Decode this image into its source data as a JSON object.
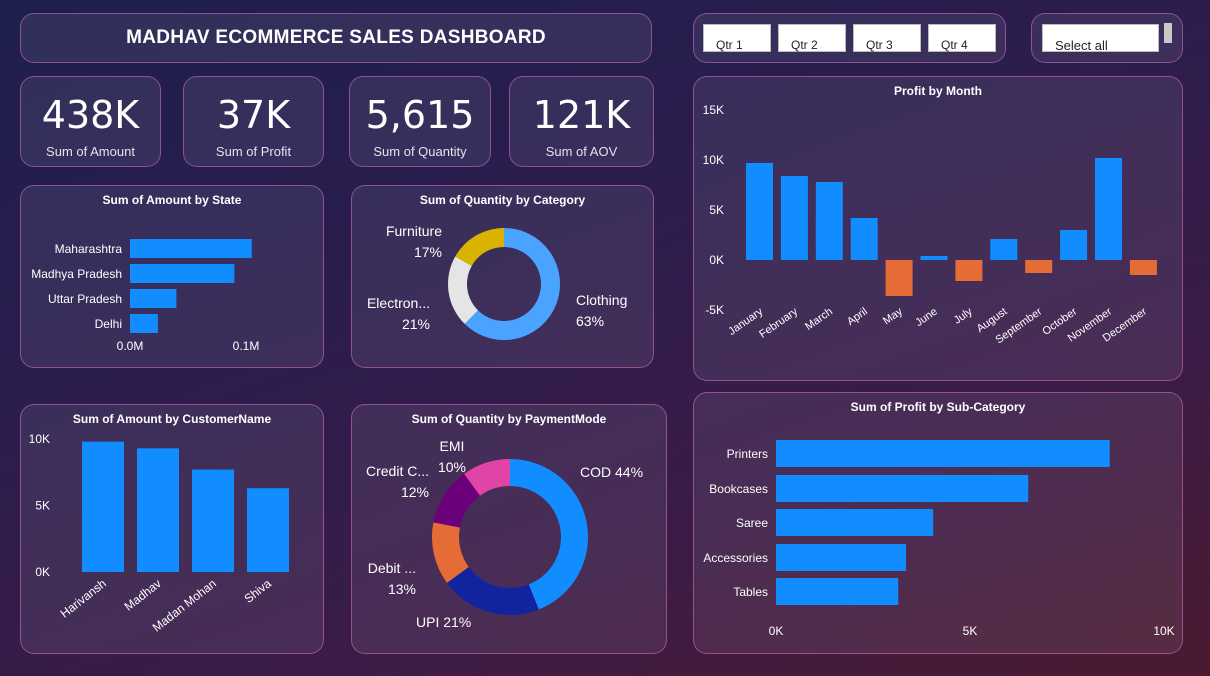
{
  "header": {
    "title": "MADHAV ECOMMERCE SALES DASHBOARD"
  },
  "slicers": {
    "quarters": [
      "Qtr 1",
      "Qtr 2",
      "Qtr 3",
      "Qtr 4"
    ],
    "select_all": "Select all"
  },
  "kpis": [
    {
      "value": "438K",
      "label": "Sum of Amount"
    },
    {
      "value": "37K",
      "label": "Sum of Profit"
    },
    {
      "value": "5,615",
      "label": "Sum of Quantity"
    },
    {
      "value": "121K",
      "label": "Sum of AOV"
    }
  ],
  "colors": {
    "blue": "#118dff",
    "orange": "#e66c37",
    "yellow": "#d9b300",
    "light": "#e5e5e5",
    "navy": "#12239e",
    "purple": "#6b007b",
    "pink": "#e044a7",
    "lightblue": "#4aa3ff"
  },
  "chart_data": [
    {
      "id": "amount_by_state",
      "type": "bar",
      "orientation": "horizontal",
      "title": "Sum of Amount by State",
      "categories": [
        "Maharashtra",
        "Madhya Pradesh",
        "Uttar Pradesh",
        "Delhi"
      ],
      "values": [
        0.105,
        0.09,
        0.04,
        0.024
      ],
      "xticks": [
        "0.0M",
        "0.1M"
      ],
      "xlim": [
        0,
        0.16
      ],
      "grid": false
    },
    {
      "id": "quantity_by_category",
      "type": "pie",
      "donut": true,
      "title": "Sum of Quantity by Category",
      "slices": [
        {
          "label": "Clothing",
          "pct": "63%",
          "value": 63,
          "color": "#4aa3ff"
        },
        {
          "label": "Electron...",
          "pct": "21%",
          "value": 21,
          "color": "#e5e5e5"
        },
        {
          "label": "Furniture",
          "pct": "17%",
          "value": 17,
          "color": "#d9b300"
        }
      ]
    },
    {
      "id": "profit_by_month",
      "type": "bar",
      "title": "Profit by Month",
      "categories": [
        "January",
        "February",
        "March",
        "April",
        "May",
        "June",
        "July",
        "August",
        "September",
        "October",
        "November",
        "December"
      ],
      "values": [
        9700,
        8400,
        7800,
        4200,
        -3600,
        400,
        -2100,
        2100,
        -1300,
        3000,
        10200,
        -1500
      ],
      "yticks": [
        "15K",
        "10K",
        "5K",
        "0K",
        "-5K"
      ],
      "ylim": [
        -5000,
        15000
      ],
      "grid": false
    },
    {
      "id": "amount_by_customer",
      "type": "bar",
      "title": "Sum of Amount by CustomerName",
      "categories": [
        "Harivansh",
        "Madhav",
        "Madan Mohan",
        "Shiva"
      ],
      "values": [
        9800,
        9300,
        7700,
        6300
      ],
      "yticks": [
        "10K",
        "5K",
        "0K"
      ],
      "ylim": [
        0,
        10000
      ],
      "grid": false
    },
    {
      "id": "quantity_by_paymentmode",
      "type": "pie",
      "donut": true,
      "title": "Sum of Quantity by PaymentMode",
      "slices": [
        {
          "label": "COD",
          "pct": "44%",
          "value": 44,
          "color": "#118dff"
        },
        {
          "label": "UPI",
          "pct": "21%",
          "value": 21,
          "color": "#12239e"
        },
        {
          "label": "Debit ...",
          "pct": "13%",
          "value": 13,
          "color": "#e66c37"
        },
        {
          "label": "Credit C...",
          "pct": "12%",
          "value": 12,
          "color": "#6b007b"
        },
        {
          "label": "EMI",
          "pct": "10%",
          "value": 10,
          "color": "#e044a7"
        }
      ]
    },
    {
      "id": "profit_by_subcategory",
      "type": "bar",
      "orientation": "horizontal",
      "title": "Sum of Profit by Sub-Category",
      "categories": [
        "Printers",
        "Bookcases",
        "Saree",
        "Accessories",
        "Tables"
      ],
      "values": [
        8600,
        6500,
        4050,
        3350,
        3150
      ],
      "xticks": [
        "0K",
        "5K",
        "10K"
      ],
      "xlim": [
        0,
        10000
      ],
      "grid": false
    }
  ]
}
